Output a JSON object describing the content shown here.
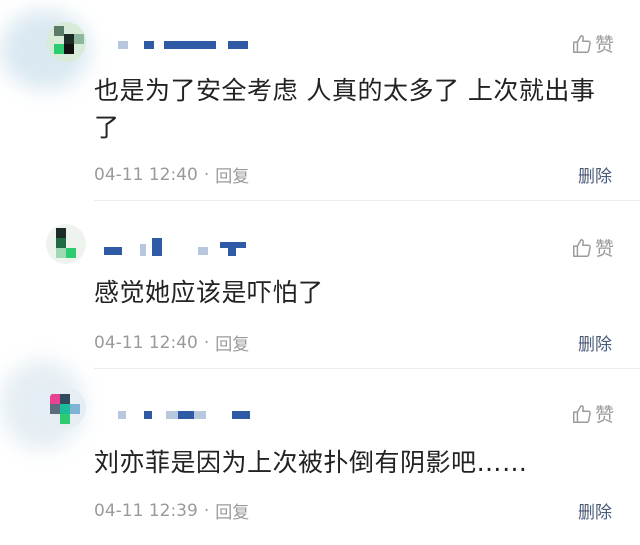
{
  "comments": [
    {
      "text": "也是为了安全考虑 人真的太多了 上次就出事了",
      "date": "04-11",
      "time": "12:40",
      "dot": "·",
      "reply": "回复",
      "like": "赞",
      "delete": "删除",
      "avatar_icon": "pixelated-avatar"
    },
    {
      "text": "感觉她应该是吓怕了",
      "date": "04-11",
      "time": "12:40",
      "dot": "·",
      "reply": "回复",
      "like": "赞",
      "delete": "删除",
      "avatar_icon": "pixelated-avatar"
    },
    {
      "text": "刘亦菲是因为上次被扑倒有阴影吧……",
      "date": "04-11",
      "time": "12:39",
      "dot": "·",
      "reply": "回复",
      "like": "赞",
      "delete": "删除",
      "avatar_icon": "pixelated-avatar"
    }
  ],
  "colors": {
    "username_blue": "#2f5aa6",
    "text": "#222222",
    "meta": "#9a9a9a",
    "delete": "#4a5a73"
  },
  "icons": {
    "like": "thumbs-up-icon"
  }
}
